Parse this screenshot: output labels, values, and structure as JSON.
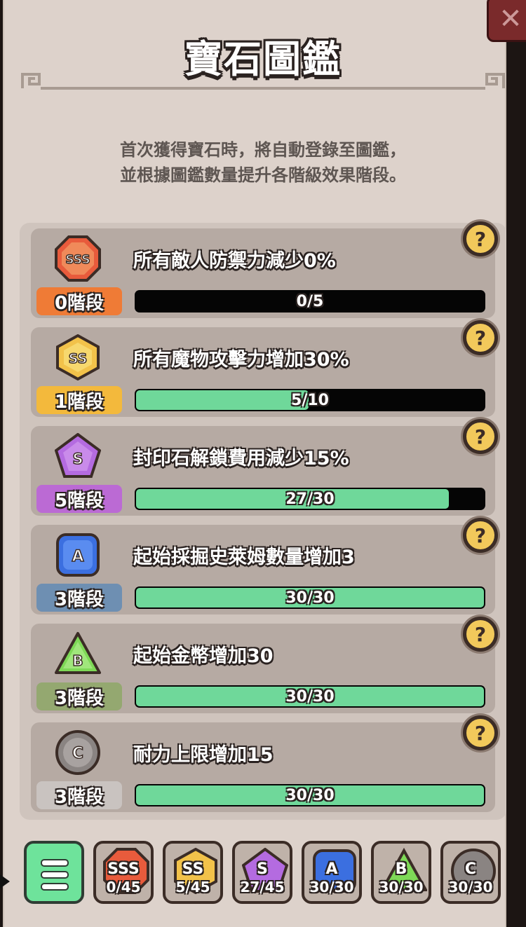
{
  "title": "寶石圖鑑",
  "close_label": "✕",
  "description": [
    "首次獲得寶石時，將自動登錄至圖鑑，",
    "並根據圖鑑數量提升各階級效果階段。"
  ],
  "help_label": "?",
  "rows": [
    {
      "grade": "SSS",
      "shape": "octagon",
      "gem_color": "#e85b3c",
      "effect": "所有敵人防禦力減少0%",
      "stage": "0階段",
      "stage_color": "#ef7b36",
      "progress_text": "0/5",
      "progress": 0.0
    },
    {
      "grade": "SS",
      "shape": "hexagon",
      "gem_color": "#f2c24a",
      "effect": "所有魔物攻擊力增加30%",
      "stage": "1階段",
      "stage_color": "#f3b93c",
      "progress_text": "5/10",
      "progress": 0.5
    },
    {
      "grade": "S",
      "shape": "pentagon",
      "gem_color": "#b46be0",
      "effect": "封印石解鎖費用減少15%",
      "stage": "5階段",
      "stage_color": "#bb6ad4",
      "progress_text": "27/30",
      "progress": 0.9
    },
    {
      "grade": "A",
      "shape": "square",
      "gem_color": "#3b6fe0",
      "effect": "起始採掘史萊姆數量增加3",
      "stage": "3階段",
      "stage_color": "#6e8fb2",
      "progress_text": "30/30",
      "progress": 1.0
    },
    {
      "grade": "B",
      "shape": "triangle",
      "gem_color": "#7ed957",
      "effect": "起始金幣增加30",
      "stage": "3階段",
      "stage_color": "#94a870",
      "progress_text": "30/30",
      "progress": 1.0
    },
    {
      "grade": "C",
      "shape": "circle",
      "gem_color": "#8a8482",
      "effect": "耐力上限增加15",
      "stage": "3階段",
      "stage_color": "#c9c3c0",
      "progress_text": "30/30",
      "progress": 1.0
    }
  ],
  "tabs": [
    {
      "grade": "SSS",
      "count": "0/45"
    },
    {
      "grade": "SS",
      "count": "5/45"
    },
    {
      "grade": "S",
      "count": "27/45"
    },
    {
      "grade": "A",
      "count": "30/30"
    },
    {
      "grade": "B",
      "count": "30/30"
    },
    {
      "grade": "C",
      "count": "30/30"
    }
  ]
}
